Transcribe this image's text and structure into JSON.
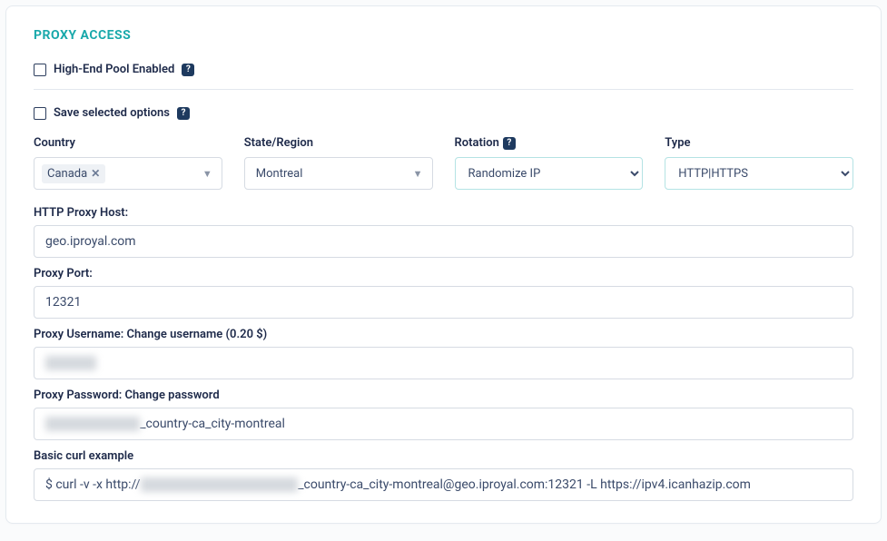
{
  "panel": {
    "title": "PROXY ACCESS"
  },
  "checkboxes": {
    "highEnd": "High-End Pool Enabled",
    "saveOptions": "Save selected options"
  },
  "grid": {
    "country": {
      "label": "Country",
      "tag": "Canada"
    },
    "state": {
      "label": "State/Region",
      "value": "Montreal"
    },
    "rotation": {
      "label": "Rotation",
      "value": "Randomize IP"
    },
    "type": {
      "label": "Type",
      "value": "HTTP|HTTPS"
    }
  },
  "fields": {
    "host": {
      "label": "HTTP Proxy Host:",
      "value": "geo.iproyal.com"
    },
    "port": {
      "label": "Proxy Port:",
      "value": "12321"
    },
    "username": {
      "label": "Proxy Username: Change username (0.20 $)",
      "masked": "xxxxxxxx"
    },
    "password": {
      "label": "Proxy Password: Change password",
      "masked": "xxxxxxxxxxxxxxx",
      "suffix": "_country-ca_city-montreal"
    },
    "curl": {
      "label": "Basic curl example",
      "prefix": "$ curl -v -x http://",
      "masked": "xxxxxxxxxxxxxxxxxxxxxxxxx",
      "suffix": "_country-ca_city-montreal@geo.iproyal.com:12321 -L https://ipv4.icanhazip.com"
    }
  },
  "helpGlyph": "?"
}
